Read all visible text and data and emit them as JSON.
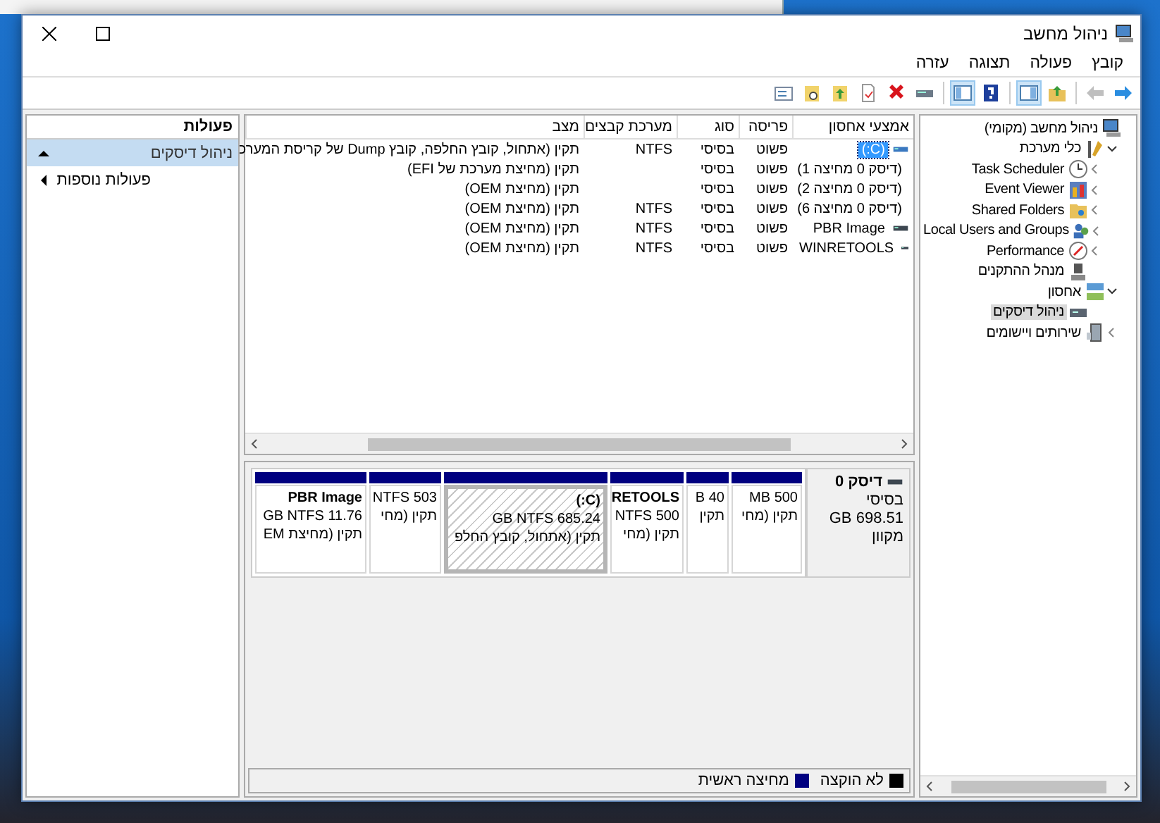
{
  "window": {
    "title": "ניהול מחשב"
  },
  "menu": [
    "קובץ",
    "פעולה",
    "תצוגה",
    "עזרה"
  ],
  "toolbar": [
    {
      "pressed": false,
      "disabled": false
    },
    {
      "pressed": false,
      "disabled": true
    },
    {
      "pressed": false,
      "disabled": false
    },
    {
      "pressed": true,
      "disabled": false
    },
    {
      "pressed": false,
      "disabled": false
    },
    {
      "pressed": true,
      "disabled": false
    },
    {
      "pressed": false,
      "disabled": false
    },
    {
      "pressed": false,
      "disabled": false
    },
    {
      "pressed": false,
      "disabled": false
    },
    {
      "pressed": false,
      "disabled": false
    },
    {
      "pressed": false,
      "disabled": false
    },
    {
      "pressed": false,
      "disabled": false
    }
  ],
  "tree": [
    {
      "label": "ניהול מחשב (מקומי)",
      "kind": "root",
      "selected": false,
      "children": [
        {
          "label": "כלי מערכת",
          "kind": "group",
          "expanded": true,
          "selected": false,
          "children": [
            {
              "label": "Task Scheduler",
              "kind": "group",
              "expanded": false,
              "selected": false
            },
            {
              "label": "Event Viewer",
              "kind": "group",
              "expanded": false,
              "selected": false
            },
            {
              "label": "Shared Folders",
              "kind": "group",
              "expanded": false,
              "selected": false
            },
            {
              "label": "Local Users and Groups",
              "kind": "group",
              "expanded": false,
              "selected": false
            },
            {
              "label": "Performance",
              "kind": "group",
              "expanded": false,
              "selected": false
            },
            {
              "label": "מנהל ההתקנים",
              "kind": "leaf",
              "selected": false
            }
          ]
        },
        {
          "label": "אחסון",
          "kind": "group",
          "expanded": true,
          "selected": false,
          "children": [
            {
              "label": "ניהול דיסקים",
              "kind": "leaf",
              "selected": true
            }
          ]
        },
        {
          "label": "שירותים ויישומים",
          "kind": "group",
          "expanded": false,
          "selected": false
        }
      ]
    }
  ],
  "volumes": {
    "columns": [
      "אמצעי אחסון",
      "פריסה",
      "סוג",
      "מערכת קבצים",
      "מצב"
    ],
    "rows": [
      {
        "volume": "(C:)",
        "layout": "פשוט",
        "type": "בסיסי",
        "fs": "NTFS",
        "status": "תקין (אתחול, קובץ החלפה, קובץ Dump של קריסת המערכ",
        "selected": true
      },
      {
        "volume": "(דיסק 0 מחיצה 1)",
        "layout": "פשוט",
        "type": "בסיסי",
        "status": "תקין (מחיצת מערכת של EFI)",
        "selected": false
      },
      {
        "volume": "(דיסק 0 מחיצה 2)",
        "layout": "פשוט",
        "type": "בסיסי",
        "status": "תקין (מחיצת OEM)",
        "selected": false
      },
      {
        "volume": "(דיסק 0 מחיצה 6)",
        "layout": "פשוט",
        "type": "בסיסי",
        "fs": "NTFS",
        "status": "תקין (מחיצת OEM)",
        "selected": false
      },
      {
        "volume": "PBR Image",
        "layout": "פשוט",
        "type": "בסיסי",
        "fs": "NTFS",
        "status": "תקין (מחיצת OEM)",
        "selected": false
      },
      {
        "volume": "WINRETOOLS",
        "layout": "פשוט",
        "type": "בסיסי",
        "fs": "NTFS",
        "status": "תקין (מחיצת OEM)",
        "selected": false
      }
    ]
  },
  "disk": {
    "name": "דיסק 0",
    "type": "בסיסי",
    "size": "698.51 GB",
    "status": "מקוון",
    "partitions": [
      {
        "size": "500 MB",
        "status": "תקין (מחי",
        "selected": false
      },
      {
        "size": "40 B",
        "status": "תקין",
        "selected": false
      },
      {
        "name": "RETOOLS",
        "size": "500 NTFS",
        "status": "תקין (מחי",
        "selected": false
      },
      {
        "name": "(C:)",
        "size": "685.24 GB NTFS",
        "status": "תקין (אתחול, קובץ החלפ",
        "selected": true
      },
      {
        "size": "503 NTFS",
        "status": "תקין (מחי",
        "selected": false
      },
      {
        "name": "PBR Image",
        "size": "11.76 GB NTFS",
        "status": "תקין (מחיצת EM",
        "selected": false
      }
    ]
  },
  "legend": [
    {
      "label": "לא הוקצה",
      "color": "#000000"
    },
    {
      "label": "מחיצה ראשית",
      "color": "#000080"
    }
  ],
  "actions": {
    "title": "פעולות",
    "items": [
      {
        "label": "ניהול דיסקים",
        "expanded": true,
        "selected": true
      },
      {
        "label": "פעולות נוספות",
        "expanded": false,
        "selected": false
      }
    ]
  }
}
